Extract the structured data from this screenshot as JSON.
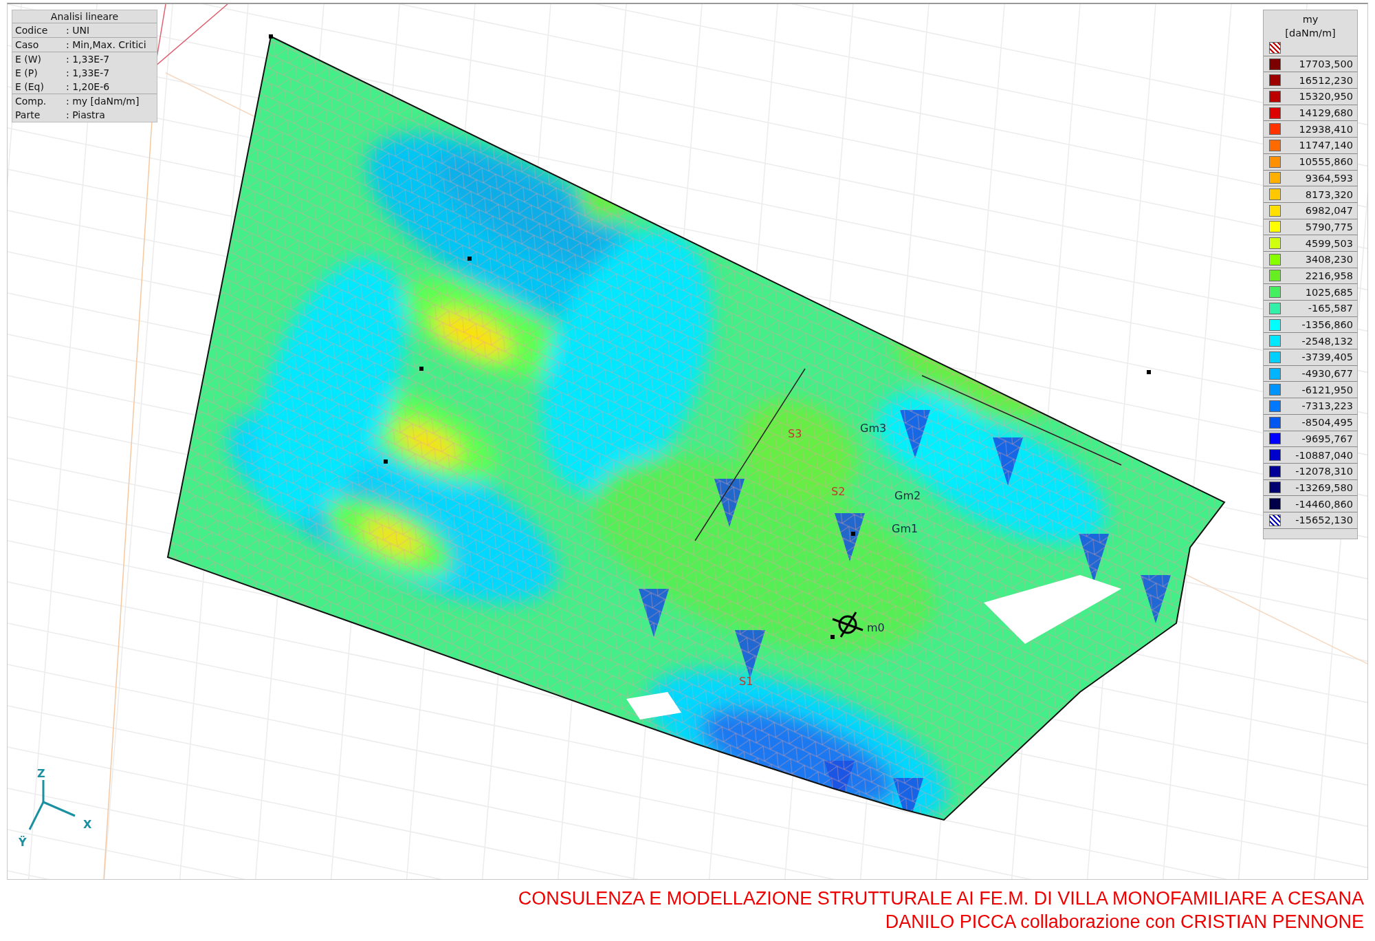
{
  "info_box": {
    "title": "Analisi lineare",
    "sections": [
      [
        {
          "label": "Codice",
          "value": ": UNI"
        }
      ],
      [
        {
          "label": "Caso",
          "value": ": Min,Max. Critici"
        }
      ],
      [
        {
          "label": "E (W)",
          "value": ": 1,33E-7"
        },
        {
          "label": "E (P)",
          "value": ": 1,33E-7"
        },
        {
          "label": "E (Eq)",
          "value": ": 1,20E-6"
        }
      ],
      [
        {
          "label": "Comp.",
          "value": ": my [daNm/m]"
        },
        {
          "label": "Parte",
          "value": ": Piastra"
        }
      ]
    ]
  },
  "legend": {
    "title": "my",
    "unit": "[daNm/m]",
    "entries": [
      {
        "kind": "hatch",
        "color": "#cc0000"
      },
      {
        "kind": "solid",
        "color": "#7c0000",
        "value": "17703,500"
      },
      {
        "kind": "solid",
        "color": "#9c0000",
        "value": "16512,230"
      },
      {
        "kind": "solid",
        "color": "#bc0000",
        "value": "15320,950"
      },
      {
        "kind": "solid",
        "color": "#dc0000",
        "value": "14129,680"
      },
      {
        "kind": "solid",
        "color": "#ff3300",
        "value": "12938,410"
      },
      {
        "kind": "solid",
        "color": "#ff6a00",
        "value": "11747,140"
      },
      {
        "kind": "solid",
        "color": "#ff9000",
        "value": "10555,860"
      },
      {
        "kind": "solid",
        "color": "#ffb000",
        "value": "9364,593"
      },
      {
        "kind": "solid",
        "color": "#ffc800",
        "value": "8173,320"
      },
      {
        "kind": "solid",
        "color": "#ffe000",
        "value": "6982,047"
      },
      {
        "kind": "solid",
        "color": "#ffff00",
        "value": "5790,775"
      },
      {
        "kind": "solid",
        "color": "#d0ff10",
        "value": "4599,503"
      },
      {
        "kind": "solid",
        "color": "#88ff00",
        "value": "3408,230"
      },
      {
        "kind": "solid",
        "color": "#66ee22",
        "value": "2216,958"
      },
      {
        "kind": "solid",
        "color": "#44f060",
        "value": "1025,685"
      },
      {
        "kind": "solid",
        "color": "#33f0a8",
        "value": "-165,587"
      },
      {
        "kind": "solid",
        "color": "#00ffff",
        "value": "-1356,860"
      },
      {
        "kind": "solid",
        "color": "#00e8ff",
        "value": "-2548,132"
      },
      {
        "kind": "solid",
        "color": "#00d0ff",
        "value": "-3739,405"
      },
      {
        "kind": "solid",
        "color": "#00b4ff",
        "value": "-4930,677"
      },
      {
        "kind": "solid",
        "color": "#0094ff",
        "value": "-6121,950"
      },
      {
        "kind": "solid",
        "color": "#0078ff",
        "value": "-7313,223"
      },
      {
        "kind": "solid",
        "color": "#0058f0",
        "value": "-8504,495"
      },
      {
        "kind": "solid",
        "color": "#0000ff",
        "value": "-9695,767"
      },
      {
        "kind": "solid",
        "color": "#0000cc",
        "value": "-10887,040"
      },
      {
        "kind": "solid",
        "color": "#000099",
        "value": "-12078,310"
      },
      {
        "kind": "solid",
        "color": "#000070",
        "value": "-13269,580"
      },
      {
        "kind": "solid",
        "color": "#000048",
        "value": "-14460,860"
      },
      {
        "kind": "hatch",
        "color": "#0000cc",
        "value": "-15652,130"
      }
    ]
  },
  "plot_labels": [
    {
      "kind": "section",
      "text": "S3"
    },
    {
      "kind": "section",
      "text": "S2"
    },
    {
      "kind": "node",
      "text": "Gm3"
    },
    {
      "kind": "node",
      "text": "Gm2"
    },
    {
      "kind": "node",
      "text": "Gm1"
    },
    {
      "kind": "node",
      "text": "m0"
    },
    {
      "kind": "section",
      "text": "S1"
    }
  ],
  "axes": {
    "z": "Z",
    "x": "X",
    "y": "Ÿ"
  },
  "caption": [
    "CONSULENZA E MODELLAZIONE STRUTTURALE AI FE.M. DI VILLA MONOFAMILIARE A CESANA",
    "DANILO PICCA collaborazione con CRISTIAN PENNONE"
  ]
}
